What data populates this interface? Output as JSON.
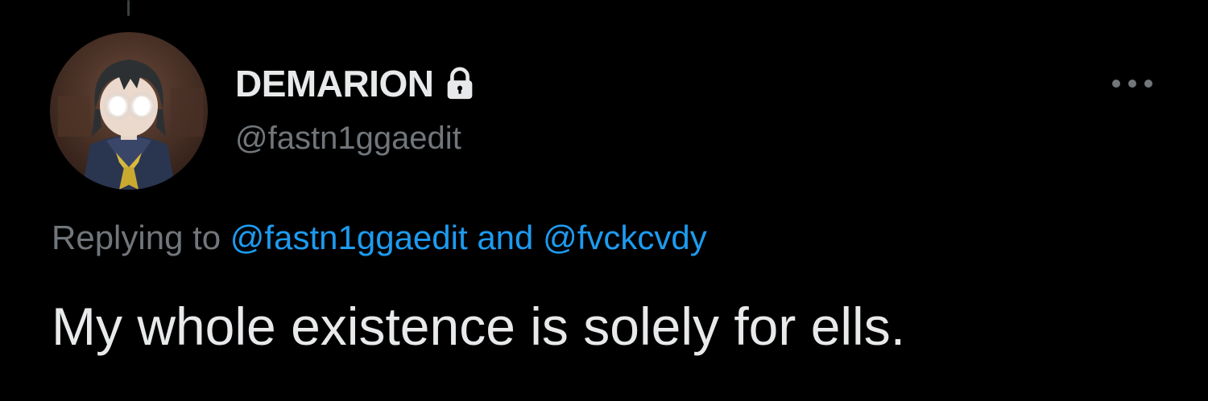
{
  "tweet": {
    "display_name": "DEMARION",
    "handle": "@fastn1ggaedit",
    "protected_icon": "lock-icon",
    "more_icon": "more-horizontal-icon",
    "reply_context": {
      "prefix": "Replying to",
      "mentions": [
        "@fastn1ggaedit",
        "@fvckcvdy"
      ],
      "joiner": "and"
    },
    "text": "My whole existence is solely for ells."
  },
  "colors": {
    "background": "#000000",
    "primary_text": "#e7e9ea",
    "secondary_text": "#71767b",
    "link": "#1d9bf0"
  }
}
